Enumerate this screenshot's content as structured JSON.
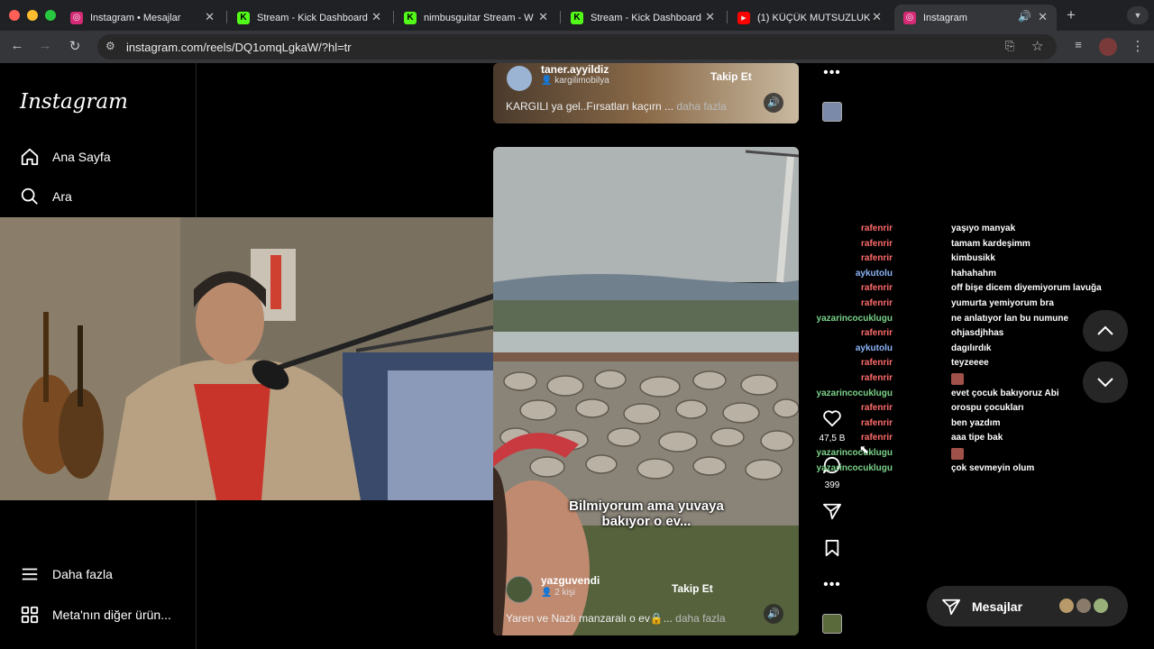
{
  "browser": {
    "tabs": [
      {
        "title": "Instagram • Mesajlar",
        "icon": "instagram-icon"
      },
      {
        "title": "Stream - Kick Dashboard",
        "icon": "kick-icon"
      },
      {
        "title": "nimbusguitar Stream - W",
        "icon": "kick-icon"
      },
      {
        "title": "Stream - Kick Dashboard",
        "icon": "kick-icon"
      },
      {
        "title": "(1) KÜÇÜK MUTSUZLUK",
        "icon": "youtube-icon"
      },
      {
        "title": "Instagram",
        "icon": "instagram-icon"
      }
    ],
    "url": "instagram.com/reels/DQ1omqLgkaW/?hl=tr",
    "colors": {
      "instagram": "#d62976",
      "kick": "#53fc18",
      "youtube": "#ff0000"
    }
  },
  "sidebar": {
    "logo": "Instagram",
    "items": [
      {
        "label": "Ana Sayfa",
        "icon": "home-icon"
      },
      {
        "label": "Ara",
        "icon": "search-icon"
      },
      {
        "label": "Daha fazla",
        "icon": "menu-icon"
      },
      {
        "label": "Meta'nın diğer ürün...",
        "icon": "grid-icon"
      }
    ]
  },
  "reels": {
    "top": {
      "user": "taner.ayyildiz",
      "sub": "kargilimobilya",
      "follow": "Takip Et",
      "caption": "KARGILI ya gel..Fırsatları kaçırn ...",
      "more": "daha fazla"
    },
    "main": {
      "user": "yazguvendi",
      "sub": "2 kişi",
      "follow": "Takip Et",
      "overlay_text": "Bilmiyorum ama yuvaya bakıyor o ev...",
      "caption": "Yaren ve Nazlı manzaralı o ev🔒...",
      "more": "daha fazla"
    }
  },
  "actions": {
    "likes": "47,5 B",
    "comments": "399"
  },
  "chat": [
    {
      "user": "rafenrir",
      "text": "yaşıyo manyak",
      "color": "#ff6b6b"
    },
    {
      "user": "rafenrir",
      "text": "tamam kardeşimm",
      "color": "#ff6b6b"
    },
    {
      "user": "rafenrir",
      "text": "kimbusikk",
      "color": "#ff6b6b"
    },
    {
      "user": "aykutolu",
      "text": "hahahahm",
      "color": "#8ab4f8"
    },
    {
      "user": "rafenrir",
      "text": "off bişe dicem diyemiyorum lavuğa",
      "color": "#ff6b6b"
    },
    {
      "user": "rafenrir",
      "text": "yumurta yemiyorum bra",
      "color": "#ff6b6b"
    },
    {
      "user": "yazarincocuklugu",
      "text": "ne anlatıyor lan bu numune",
      "color": "#7bd389"
    },
    {
      "user": "rafenrir",
      "text": "ohjasdjhhas",
      "color": "#ff6b6b"
    },
    {
      "user": "aykutolu",
      "text": "dagılırdık",
      "color": "#8ab4f8"
    },
    {
      "user": "rafenrir",
      "text": "teyzeeee",
      "color": "#ff6b6b"
    },
    {
      "user": "rafenrir",
      "text": "",
      "emote": true,
      "color": "#ff6b6b"
    },
    {
      "user": "yazarincocuklugu",
      "text": "evet çocuk bakıyoruz Abi",
      "color": "#7bd389"
    },
    {
      "user": "rafenrir",
      "text": "orospu çocukları",
      "color": "#ff6b6b"
    },
    {
      "user": "rafenrir",
      "text": "ben yazdım",
      "color": "#ff6b6b"
    },
    {
      "user": "rafenrir",
      "text": "aaa tipe bak",
      "color": "#ff6b6b"
    },
    {
      "user": "yazarincocuklugu",
      "text": "",
      "emote": true,
      "color": "#7bd389"
    },
    {
      "user": "yazarincocuklugu",
      "text": "çok sevmeyin olum",
      "color": "#7bd389"
    }
  ],
  "messages_button": {
    "label": "Mesajlar"
  }
}
